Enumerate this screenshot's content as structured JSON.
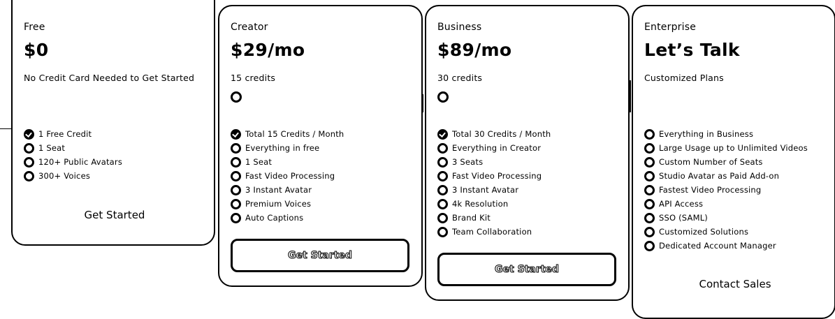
{
  "plans": [
    {
      "name": "Free",
      "price": "$0",
      "subtitle": "No Credit Card Needed to Get Started",
      "features": [
        {
          "text": "1 Free Credit",
          "icon": "check-icon"
        },
        {
          "text": "1 Seat",
          "icon": "circle-icon"
        },
        {
          "text": "120+ Public Avatars",
          "icon": "circle-icon"
        },
        {
          "text": "300+ Voices",
          "icon": "circle-icon"
        }
      ],
      "cta": "Get Started"
    },
    {
      "name": "Creator",
      "price": "$29/mo",
      "subtitle": "15 credits",
      "features": [
        {
          "text": "Total 15 Credits / Month",
          "icon": "check-icon"
        },
        {
          "text": "Everything in free",
          "icon": "circle-icon"
        },
        {
          "text": "1 Seat",
          "icon": "circle-icon"
        },
        {
          "text": "Fast Video Processing",
          "icon": "circle-icon"
        },
        {
          "text": "3 Instant Avatar",
          "icon": "circle-icon"
        },
        {
          "text": "Premium Voices",
          "icon": "circle-icon"
        },
        {
          "text": "Auto Captions",
          "icon": "circle-icon"
        }
      ],
      "cta": "Get Started"
    },
    {
      "name": "Business",
      "price": "$89/mo",
      "subtitle": "30 credits",
      "features": [
        {
          "text": "Total 30 Credits / Month",
          "icon": "check-icon"
        },
        {
          "text": "Everything in Creator",
          "icon": "circle-icon"
        },
        {
          "text": "3 Seats",
          "icon": "circle-icon"
        },
        {
          "text": "Fast Video Processing",
          "icon": "circle-icon"
        },
        {
          "text": "3 Instant Avatar",
          "icon": "circle-icon"
        },
        {
          "text": "4k Resolution",
          "icon": "circle-icon"
        },
        {
          "text": "Brand Kit",
          "icon": "circle-icon"
        },
        {
          "text": "Team Collaboration",
          "icon": "circle-icon"
        }
      ],
      "cta": "Get Started"
    },
    {
      "name": "Enterprise",
      "price": "Let’s Talk",
      "subtitle": "Customized Plans",
      "features": [
        {
          "text": "Everything in Business",
          "icon": "circle-icon"
        },
        {
          "text": "Large Usage up to Unlimited Videos",
          "icon": "circle-icon"
        },
        {
          "text": "Custom Number of Seats",
          "icon": "circle-icon"
        },
        {
          "text": "Studio Avatar as Paid Add-on",
          "icon": "circle-icon"
        },
        {
          "text": "Fastest Video Processing",
          "icon": "circle-icon"
        },
        {
          "text": "API Access",
          "icon": "circle-icon"
        },
        {
          "text": "SSO (SAML)",
          "icon": "circle-icon"
        },
        {
          "text": "Customized Solutions",
          "icon": "circle-icon"
        },
        {
          "text": "Dedicated Account Manager",
          "icon": "circle-icon"
        }
      ],
      "cta": "Contact Sales"
    }
  ]
}
